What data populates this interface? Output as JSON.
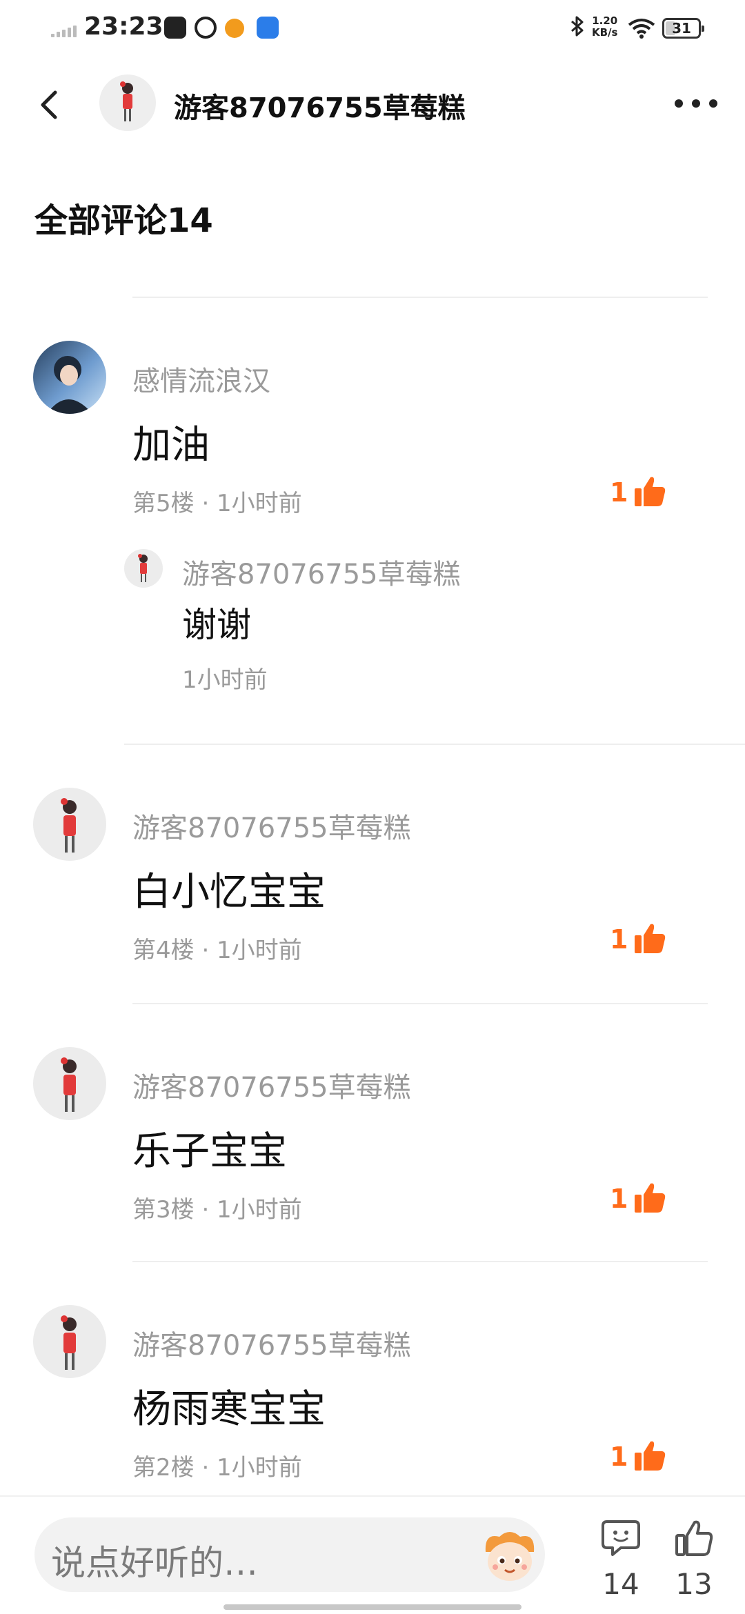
{
  "status_bar": {
    "time": "23:23",
    "net_speed_value": "1.20",
    "net_speed_unit": "KB/s",
    "battery": "31",
    "icons": [
      "signal-icon",
      "messenger-app-icon",
      "qq-browser-app-icon",
      "weibo-app-icon",
      "app-store-icon",
      "bluetooth-icon",
      "wifi-icon",
      "battery-icon"
    ]
  },
  "header": {
    "title": "游客87076755草莓糕"
  },
  "section": {
    "title": "全部评论14"
  },
  "colors": {
    "accent": "#ff6b1a",
    "muted_text": "#9a9a9a",
    "divider": "#eeeeee"
  },
  "comments": [
    {
      "name": "感情流浪汉",
      "text": "加油",
      "meta": "第5楼 · 1小时前",
      "likes": "1",
      "reply": {
        "name": "游客87076755草莓糕",
        "text": "谢谢",
        "meta": "1小时前"
      }
    },
    {
      "name": "游客87076755草莓糕",
      "text": "白小忆宝宝",
      "meta": "第4楼 · 1小时前",
      "likes": "1"
    },
    {
      "name": "游客87076755草莓糕",
      "text": "乐子宝宝",
      "meta": "第3楼 · 1小时前",
      "likes": "1"
    },
    {
      "name": "游客87076755草莓糕",
      "text": "杨雨寒宝宝",
      "meta": "第2楼 · 1小时前",
      "likes": "1"
    }
  ],
  "bottom_bar": {
    "placeholder": "说点好听的…",
    "comment_count": "14",
    "like_count": "13"
  }
}
